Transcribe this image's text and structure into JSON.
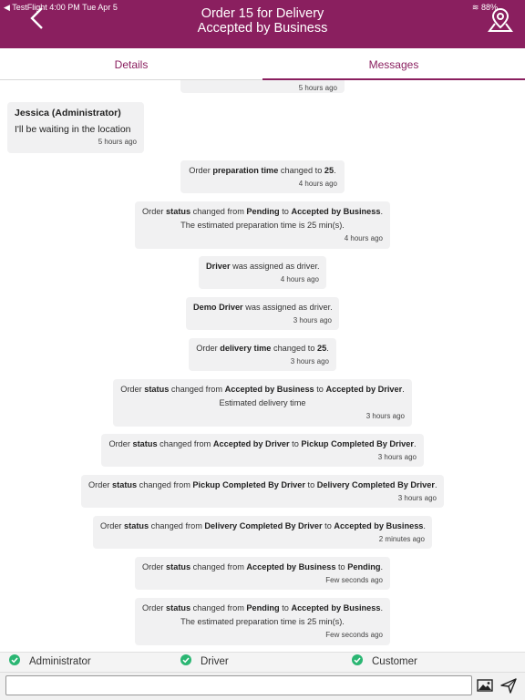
{
  "status_bar": {
    "left": "◀ TestFlight   4:00 PM   Tue Apr 5",
    "right": "88%"
  },
  "header": {
    "title_line1": "Order 15 for Delivery",
    "title_line2": "Accepted by Business"
  },
  "tabs": [
    {
      "label": "Details"
    },
    {
      "label": "Messages"
    }
  ],
  "messages": {
    "top_partial_ts": "5 hours ago",
    "user_message": {
      "author": "Jessica (Administrator)",
      "text": "I'll be waiting in the location",
      "ts": "5 hours ago"
    },
    "m1": {
      "a": "Order ",
      "b": "preparation time",
      "c": " changed to ",
      "d": "25",
      "e": ".",
      "ts": "4 hours ago"
    },
    "m2": {
      "a": "Order ",
      "b": "status",
      "c": " changed from ",
      "d": "Pending",
      "e": " to ",
      "f": "Accepted by Business",
      "g": ".",
      "line2": "The estimated preparation time is 25 min(s).",
      "ts": "4 hours ago"
    },
    "m3": {
      "b": "Driver",
      "c": " was assigned as driver.",
      "ts": "4 hours ago"
    },
    "m4": {
      "b": "Demo Driver",
      "c": " was assigned as driver.",
      "ts": "3 hours ago"
    },
    "m5": {
      "a": "Order ",
      "b": "delivery time",
      "c": " changed to ",
      "d": "25",
      "e": ".",
      "ts": "3 hours ago"
    },
    "m6": {
      "a": "Order ",
      "b": "status",
      "c": " changed from ",
      "d": "Accepted by Business",
      "e": " to ",
      "f": "Accepted by Driver",
      "g": ".",
      "line2": "Estimated delivery time",
      "ts": "3 hours ago"
    },
    "m7": {
      "a": "Order ",
      "b": "status",
      "c": " changed from ",
      "d": "Accepted by Driver",
      "e": " to ",
      "f": "Pickup Completed By Driver",
      "g": ".",
      "ts": "3 hours ago"
    },
    "m8": {
      "a": "Order ",
      "b": "status",
      "c": " changed from ",
      "d": "Pickup Completed By Driver",
      "e": " to ",
      "f": "Delivery Completed By Driver",
      "g": ".",
      "ts": "3 hours ago"
    },
    "m9": {
      "a": "Order ",
      "b": "status",
      "c": " changed from ",
      "d": "Delivery Completed By Driver",
      "e": " to ",
      "f": "Accepted by Business",
      "g": ".",
      "ts": "2 minutes ago"
    },
    "m10": {
      "a": "Order ",
      "b": "status",
      "c": " changed from ",
      "d": "Accepted by Business",
      "e": " to ",
      "f": "Pending",
      "g": ".",
      "ts": "Few seconds ago"
    },
    "m11": {
      "a": "Order ",
      "b": "status",
      "c": " changed from ",
      "d": "Pending",
      "e": " to ",
      "f": "Accepted by Business",
      "g": ".",
      "line2": "The estimated preparation time is 25 min(s).",
      "ts": "Few seconds ago"
    }
  },
  "recipients": [
    {
      "label": "Administrator"
    },
    {
      "label": "Driver"
    },
    {
      "label": "Customer"
    }
  ],
  "composer": {
    "value": "",
    "placeholder": ""
  },
  "colors": {
    "brand": "#8a1f5f",
    "check": "#2bb673",
    "bubble": "#f1f1f2"
  },
  "icons": {
    "back": "chevron-left-icon",
    "map": "map-pin-icon",
    "check": "check-circle-icon",
    "image": "image-icon",
    "send": "send-icon"
  }
}
